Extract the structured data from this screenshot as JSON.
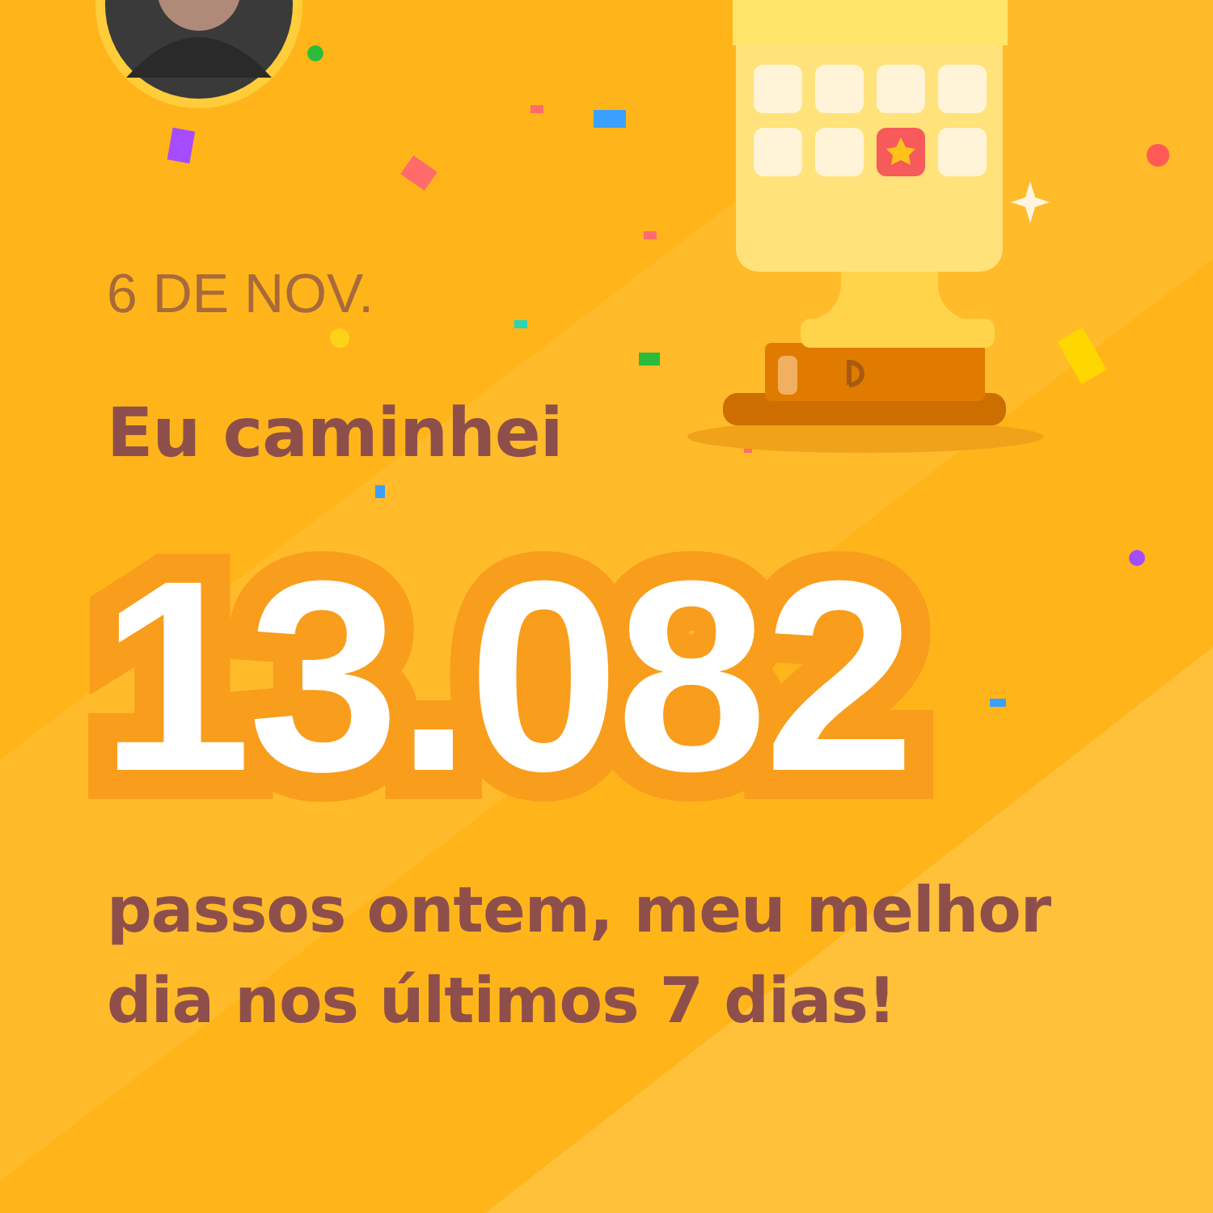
{
  "date": "6 DE NOV.",
  "headline": "Eu caminhei",
  "steps": "13.082",
  "caption": "passos ontem, meu melhor dia nos últimos 7 dias!"
}
